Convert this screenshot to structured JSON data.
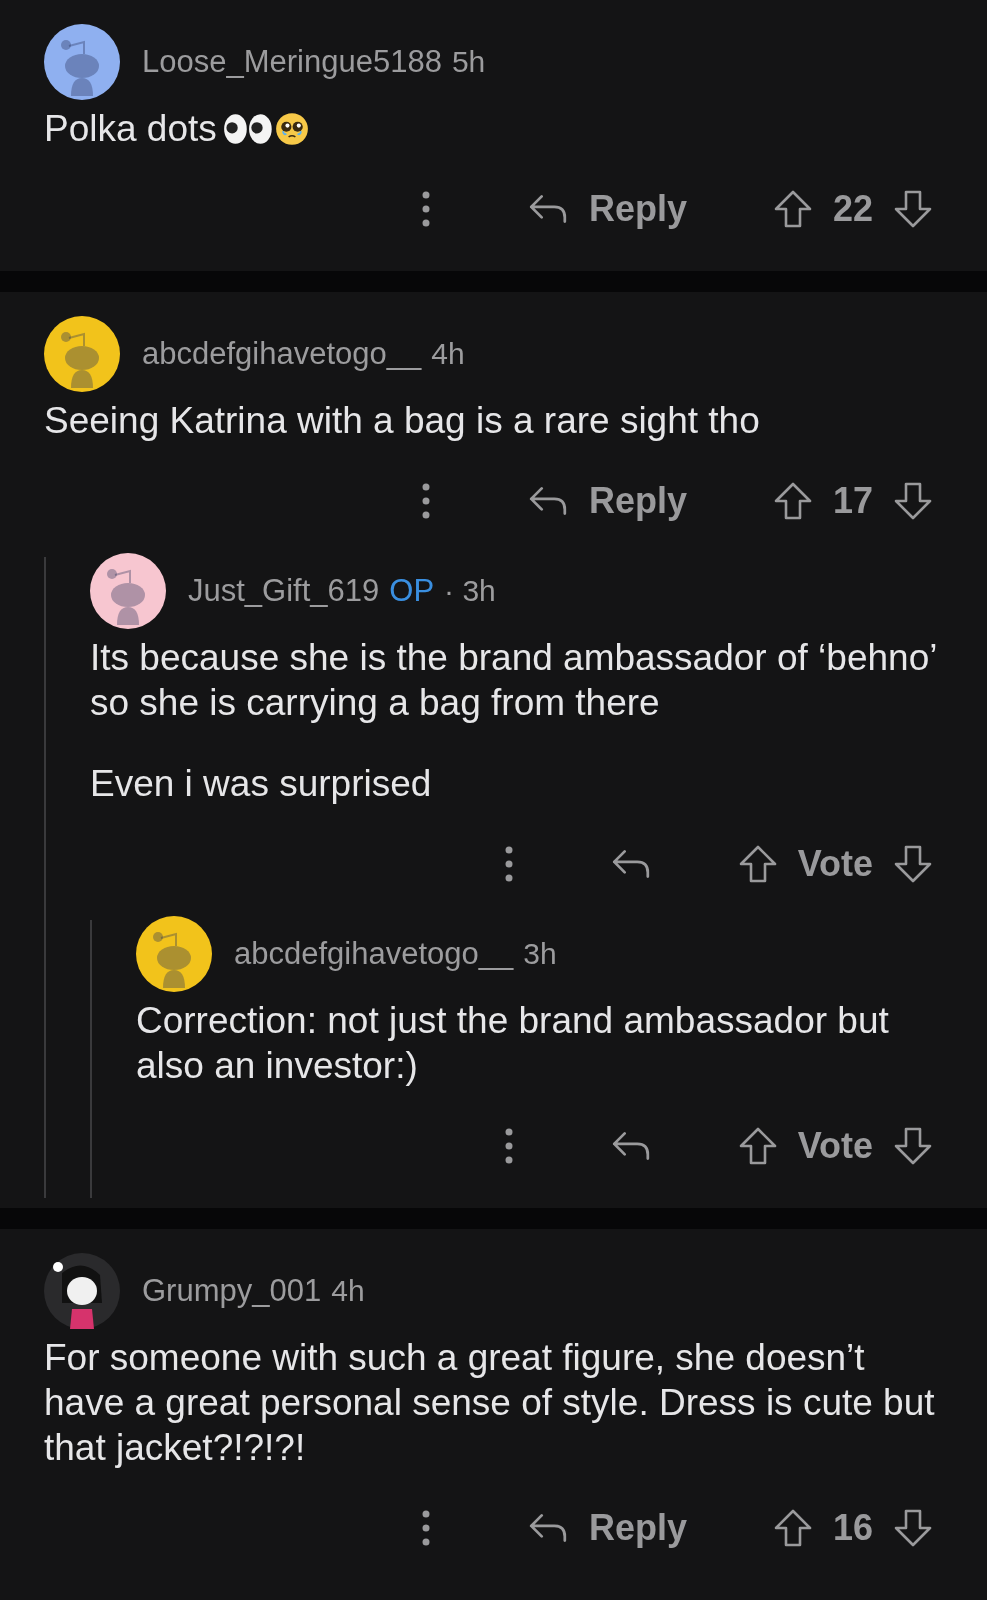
{
  "threads": [
    {
      "comment": {
        "author": "Loose_Meringue5188",
        "time": "5h",
        "avatar": {
          "kind": "snoo",
          "color": "#8fb0f0"
        },
        "paragraphs": [
          "Polka dots"
        ],
        "emoji": [
          {
            "kind": "eyes"
          },
          {
            "kind": "pleading"
          }
        ],
        "actions": {
          "reply_label": "Reply",
          "vote_label": "22"
        }
      }
    },
    {
      "comment": {
        "author": "abcdefgihavetogo__",
        "time": "4h",
        "avatar": {
          "kind": "snoo",
          "color": "#f2c31b"
        },
        "paragraphs": [
          "Seeing Katrina with a bag is a rare sight tho"
        ],
        "actions": {
          "reply_label": "Reply",
          "vote_label": "17"
        },
        "children": [
          {
            "author": "Just_Gift_619",
            "op_badge": "OP",
            "time": "· 3h",
            "avatar": {
              "kind": "snoo",
              "color": "#f7c6d0"
            },
            "paragraphs": [
              "Its because she is the brand ambassador of ‘behno’ so she is carrying a bag from there",
              "Even i was surprised"
            ],
            "actions": {
              "vote_label": "Vote"
            },
            "children": [
              {
                "author": "abcdefgihavetogo__",
                "time": "3h",
                "avatar": {
                  "kind": "snoo",
                  "color": "#f2c31b"
                },
                "paragraphs": [
                  "Correction: not just the brand ambassador but also an investor:)"
                ],
                "actions": {
                  "vote_label": "Vote"
                }
              }
            ]
          }
        ]
      }
    },
    {
      "comment": {
        "author": "Grumpy_001",
        "time": "4h",
        "avatar": {
          "kind": "custom",
          "color": "#2a2a2c"
        },
        "paragraphs": [
          "For someone with such a great figure, she doesn’t have a great personal sense of style. Dress is cute but that jacket?!?!?!"
        ],
        "actions": {
          "reply_label": "Reply",
          "vote_label": "16"
        }
      }
    }
  ]
}
